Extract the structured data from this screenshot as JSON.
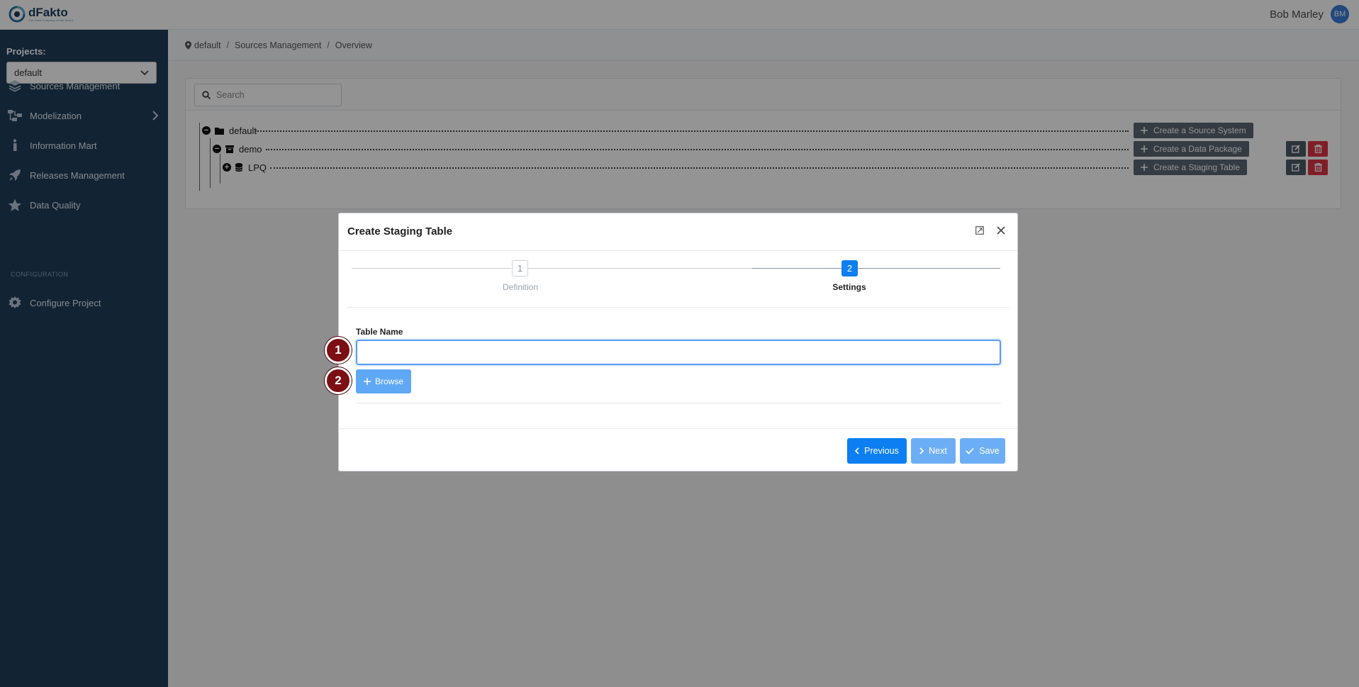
{
  "app": {
    "logo_text": "dFakto",
    "logo_tagline": "The Data Company of the future"
  },
  "user": {
    "name": "Bob Marley",
    "initials": "BM"
  },
  "sidebar": {
    "projects_label": "Projects:",
    "project_selected": "default",
    "items": [
      {
        "label": "Sources Management",
        "icon": "layers-icon"
      },
      {
        "label": "Modelization",
        "icon": "hierarchy-icon"
      },
      {
        "label": "Information Mart",
        "icon": "info-icon"
      },
      {
        "label": "Releases Management",
        "icon": "rocket-icon"
      },
      {
        "label": "Data Quality",
        "icon": "star-icon"
      }
    ],
    "section_title": "CONFIGURATION",
    "config_items": [
      {
        "label": "Configure Project",
        "icon": "gear-icon"
      }
    ]
  },
  "breadcrumb": [
    "default",
    "Sources Management",
    "Overview"
  ],
  "search": {
    "placeholder": "Search"
  },
  "tree": {
    "root": {
      "label": "default",
      "action": "Create a Source System"
    },
    "child": {
      "label": "demo",
      "action": "Create a Data Package"
    },
    "leaf": {
      "label": "LPQ",
      "action": "Create a Staging Table"
    }
  },
  "modal": {
    "title": "Create Staging Table",
    "steps": [
      {
        "number": "1",
        "label": "Definition"
      },
      {
        "number": "2",
        "label": "Settings"
      }
    ],
    "active_step": 2,
    "table_name_label": "Table Name",
    "table_name_value": "",
    "browse_label": "Browse",
    "previous_label": "Previous",
    "next_label": "Next",
    "save_label": "Save"
  },
  "callouts": [
    "1",
    "2"
  ],
  "colors": {
    "sidebar_bg": "#1f3d59",
    "primary": "#0d7ff2",
    "primary_disabled": "#6caef5",
    "danger": "#dc3545",
    "callout": "#7b0f14"
  }
}
